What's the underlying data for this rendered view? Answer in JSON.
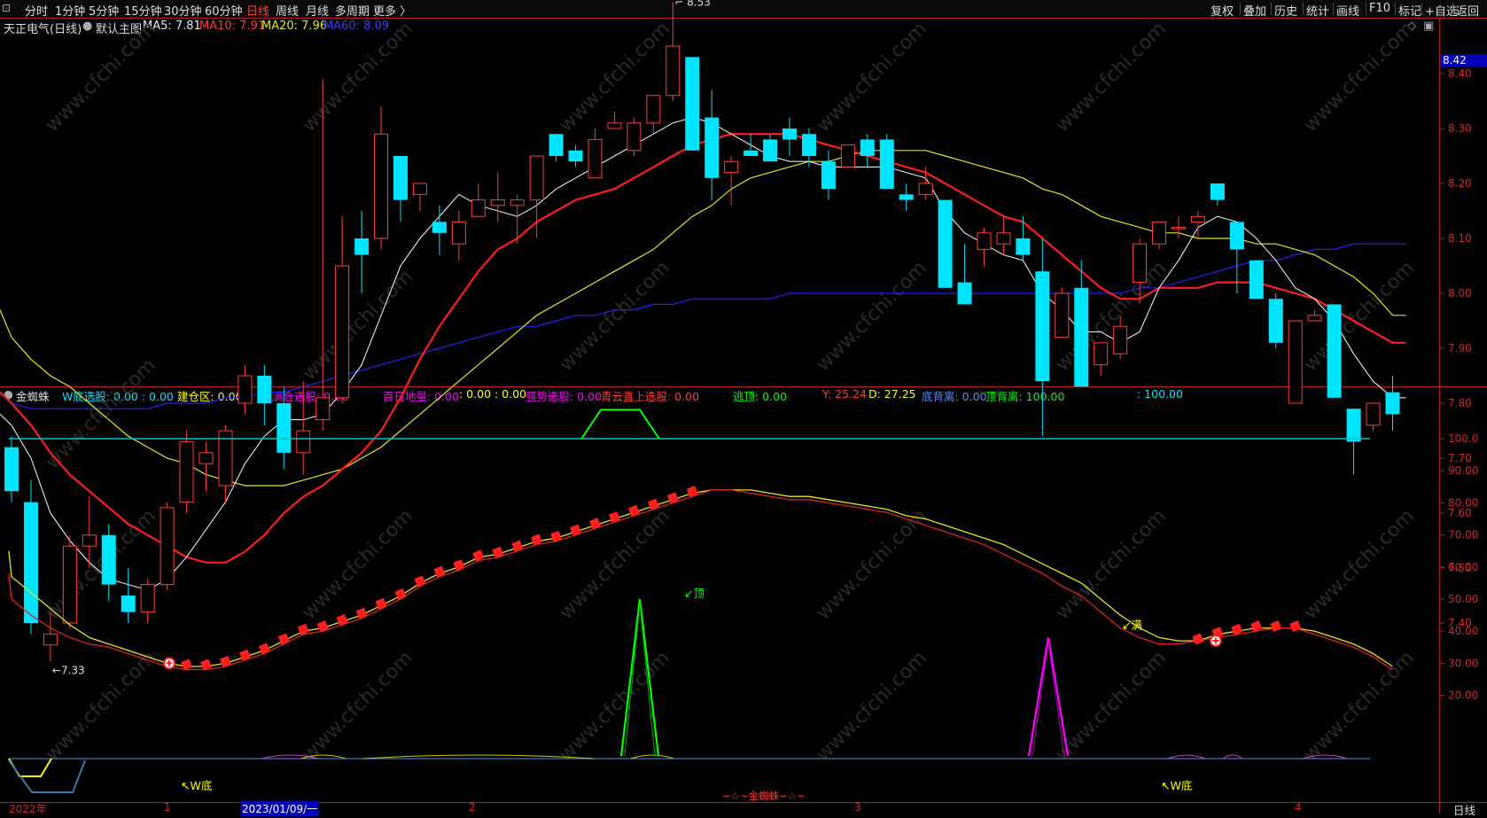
{
  "toolbar": {
    "left_tabs": [
      "分时",
      "1分钟",
      "5分钟",
      "15分钟",
      "30分钟",
      "60分钟",
      "日线",
      "周线",
      "月线",
      "多周期",
      "更多 〉"
    ],
    "active_tab": "日线",
    "right_tabs": [
      "复权",
      "叠加",
      "历史",
      "统计",
      "画线",
      "F10",
      "标记",
      "+自选",
      "返回"
    ]
  },
  "main_chart": {
    "title": "天正电气(日线)",
    "template": "默认主图",
    "ma5": "MA5: 7.81",
    "ma10": "MA10: 7.91",
    "ma20": "MA20: 7.96",
    "ma60": "MA60: 8.09",
    "high_label": "8.53",
    "low_label": "7.33",
    "price_now": "8.42",
    "y_ticks": [
      "8.40",
      "8.30",
      "8.20",
      "8.10",
      "8.00",
      "7.90",
      "7.80",
      "7.70",
      "7.60",
      "7.50",
      "7.40"
    ],
    "colors": {
      "up": "#ff3c3c",
      "down": "#00e5ff",
      "ma5": "#e8e8e8",
      "ma10": "#ff1e1e",
      "ma20": "#e6e61e",
      "ma60": "#2222ff"
    },
    "candles": [
      [
        7.72,
        7.74,
        7.62,
        7.64
      ],
      [
        7.62,
        7.66,
        7.38,
        7.4
      ],
      [
        7.36,
        7.42,
        7.33,
        7.38
      ],
      [
        7.4,
        7.56,
        7.39,
        7.54
      ],
      [
        7.54,
        7.63,
        7.5,
        7.56
      ],
      [
        7.56,
        7.58,
        7.44,
        7.47
      ],
      [
        7.45,
        7.5,
        7.4,
        7.42
      ],
      [
        7.42,
        7.48,
        7.4,
        7.47
      ],
      [
        7.47,
        7.62,
        7.46,
        7.61
      ],
      [
        7.62,
        7.75,
        7.6,
        7.73
      ],
      [
        7.69,
        7.73,
        7.64,
        7.71
      ],
      [
        7.65,
        7.76,
        7.62,
        7.75
      ],
      [
        7.8,
        7.87,
        7.78,
        7.85
      ],
      [
        7.85,
        7.87,
        7.76,
        7.8
      ],
      [
        7.8,
        7.83,
        7.68,
        7.71
      ],
      [
        7.71,
        7.84,
        7.67,
        7.75
      ],
      [
        7.77,
        8.39,
        7.75,
        7.81
      ],
      [
        7.81,
        8.14,
        7.8,
        8.05
      ],
      [
        8.1,
        8.15,
        8.0,
        8.07
      ],
      [
        8.1,
        8.34,
        8.08,
        8.29
      ],
      [
        8.25,
        8.25,
        8.13,
        8.17
      ],
      [
        8.18,
        8.2,
        8.15,
        8.2
      ],
      [
        8.13,
        8.16,
        8.07,
        8.11
      ],
      [
        8.09,
        8.15,
        8.06,
        8.13
      ],
      [
        8.14,
        8.2,
        8.14,
        8.17
      ],
      [
        8.16,
        8.22,
        8.13,
        8.17
      ],
      [
        8.16,
        8.18,
        8.09,
        8.17
      ],
      [
        8.17,
        8.25,
        8.1,
        8.25
      ],
      [
        8.29,
        8.29,
        8.24,
        8.25
      ],
      [
        8.26,
        8.27,
        8.23,
        8.24
      ],
      [
        8.21,
        8.3,
        8.21,
        8.28
      ],
      [
        8.3,
        8.33,
        8.3,
        8.31
      ],
      [
        8.26,
        8.32,
        8.25,
        8.31
      ],
      [
        8.31,
        8.36,
        8.29,
        8.36
      ],
      [
        8.36,
        8.53,
        8.35,
        8.45
      ],
      [
        8.43,
        8.43,
        8.26,
        8.26
      ],
      [
        8.32,
        8.37,
        8.17,
        8.21
      ],
      [
        8.22,
        8.25,
        8.16,
        8.24
      ],
      [
        8.26,
        8.29,
        8.25,
        8.25
      ],
      [
        8.28,
        8.29,
        8.24,
        8.24
      ],
      [
        8.3,
        8.32,
        8.25,
        8.28
      ],
      [
        8.29,
        8.3,
        8.23,
        8.25
      ],
      [
        8.24,
        8.26,
        8.17,
        8.19
      ],
      [
        8.23,
        8.27,
        8.23,
        8.27
      ],
      [
        8.28,
        8.29,
        8.23,
        8.25
      ],
      [
        8.28,
        8.29,
        8.19,
        8.19
      ],
      [
        8.18,
        8.2,
        8.15,
        8.17
      ],
      [
        8.18,
        8.23,
        8.17,
        8.2
      ],
      [
        8.17,
        8.17,
        8.01,
        8.01
      ],
      [
        8.02,
        8.09,
        7.98,
        7.98
      ],
      [
        8.08,
        8.12,
        8.05,
        8.11
      ],
      [
        8.09,
        8.14,
        8.07,
        8.11
      ],
      [
        8.1,
        8.14,
        8.06,
        8.07
      ],
      [
        8.04,
        8.1,
        7.74,
        7.84
      ],
      [
        7.92,
        8.01,
        7.92,
        8.0
      ],
      [
        8.01,
        8.06,
        7.83,
        7.83
      ],
      [
        7.87,
        7.91,
        7.85,
        7.91
      ],
      [
        7.89,
        7.96,
        7.88,
        7.94
      ],
      [
        8.02,
        8.1,
        7.98,
        8.09
      ],
      [
        8.09,
        8.13,
        8.08,
        8.13
      ],
      [
        8.12,
        8.14,
        8.1,
        8.12
      ],
      [
        8.13,
        8.15,
        8.1,
        8.14
      ],
      [
        8.2,
        8.2,
        8.16,
        8.17
      ],
      [
        8.13,
        8.13,
        8.0,
        8.08
      ],
      [
        8.06,
        8.06,
        7.99,
        7.99
      ],
      [
        7.99,
        8.0,
        7.9,
        7.91
      ],
      [
        7.8,
        7.95,
        7.8,
        7.95
      ],
      [
        7.95,
        7.97,
        7.95,
        7.96
      ],
      [
        7.98,
        7.98,
        7.81,
        7.81
      ],
      [
        7.79,
        7.79,
        7.67,
        7.73
      ],
      [
        7.76,
        7.8,
        7.75,
        7.8
      ],
      [
        7.82,
        7.85,
        7.75,
        7.78
      ]
    ],
    "ma5_values": [
      7.76,
      7.7,
      7.6,
      7.55,
      7.51,
      7.48,
      7.47,
      7.46,
      7.48,
      7.52,
      7.57,
      7.62,
      7.69,
      7.74,
      7.77,
      7.77,
      7.78,
      7.82,
      7.87,
      7.96,
      8.05,
      8.1,
      8.14,
      8.18,
      8.16,
      8.15,
      8.14,
      8.16,
      8.19,
      8.21,
      8.23,
      8.25,
      8.27,
      8.29,
      8.31,
      8.32,
      8.31,
      8.29,
      8.27,
      8.25,
      8.24,
      8.24,
      8.23,
      8.23,
      8.23,
      8.23,
      8.22,
      8.21,
      8.15,
      8.11,
      8.09,
      8.07,
      8.06,
      8.0,
      7.97,
      7.93,
      7.93,
      7.91,
      7.93,
      8.01,
      8.06,
      8.12,
      8.14,
      8.13,
      8.1,
      8.06,
      8.01,
      7.99,
      7.95,
      7.89,
      7.84,
      7.81
    ],
    "ma10_values": [
      7.8,
      7.76,
      7.71,
      7.67,
      7.64,
      7.61,
      7.58,
      7.56,
      7.54,
      7.52,
      7.51,
      7.51,
      7.53,
      7.56,
      7.6,
      7.63,
      7.65,
      7.68,
      7.71,
      7.75,
      7.81,
      7.88,
      7.94,
      7.99,
      8.04,
      8.08,
      8.1,
      8.13,
      8.15,
      8.17,
      8.18,
      8.19,
      8.21,
      8.23,
      8.25,
      8.27,
      8.28,
      8.29,
      8.29,
      8.29,
      8.29,
      8.28,
      8.27,
      8.26,
      8.25,
      8.24,
      8.23,
      8.22,
      8.2,
      8.18,
      8.16,
      8.14,
      8.13,
      8.1,
      8.07,
      8.04,
      8.01,
      7.99,
      7.99,
      8.01,
      8.01,
      8.01,
      8.02,
      8.02,
      8.02,
      8.01,
      8.0,
      7.99,
      7.97,
      7.95,
      7.93,
      7.91
    ],
    "ma20_values": [
      7.92,
      7.88,
      7.85,
      7.83,
      7.8,
      7.77,
      7.74,
      7.72,
      7.7,
      7.69,
      7.67,
      7.66,
      7.65,
      7.65,
      7.65,
      7.66,
      7.67,
      7.68,
      7.7,
      7.72,
      7.75,
      7.78,
      7.81,
      7.84,
      7.87,
      7.9,
      7.93,
      7.96,
      7.98,
      8.0,
      8.02,
      8.04,
      8.06,
      8.08,
      8.11,
      8.14,
      8.16,
      8.19,
      8.21,
      8.22,
      8.23,
      8.24,
      8.24,
      8.25,
      8.26,
      8.26,
      8.26,
      8.26,
      8.25,
      8.24,
      8.23,
      8.22,
      8.21,
      8.19,
      8.18,
      8.16,
      8.14,
      8.13,
      8.12,
      8.11,
      8.11,
      8.1,
      8.1,
      8.1,
      8.09,
      8.09,
      8.08,
      8.07,
      8.05,
      8.03,
      8.0,
      7.96
    ],
    "ma60_values": [
      7.8,
      7.79,
      7.79,
      7.79,
      7.79,
      7.79,
      7.79,
      7.79,
      7.8,
      7.8,
      7.8,
      7.81,
      7.81,
      7.82,
      7.82,
      7.83,
      7.84,
      7.85,
      7.86,
      7.87,
      7.88,
      7.89,
      7.9,
      7.91,
      7.92,
      7.93,
      7.94,
      7.94,
      7.95,
      7.96,
      7.96,
      7.97,
      7.97,
      7.98,
      7.98,
      7.99,
      7.99,
      7.99,
      7.99,
      7.99,
      8.0,
      8.0,
      8.0,
      8.0,
      8.0,
      8.0,
      8.0,
      8.0,
      8.0,
      8.0,
      8.0,
      8.0,
      8.0,
      8.0,
      8.0,
      8.0,
      8.0,
      8.0,
      8.01,
      8.01,
      8.02,
      8.03,
      8.04,
      8.05,
      8.06,
      8.06,
      8.07,
      8.08,
      8.08,
      8.09,
      8.09,
      8.09
    ]
  },
  "indicator": {
    "name": "金蜘蛛",
    "w_bottom": "W底选股: 0.00 : 0.00",
    "build_zone": "建仓区: 0.00",
    "full_position": "满仓选股: 0.00",
    "hundred_day_low": "百日地量: 0.00",
    "colon_values": ": 0.00 : 0.00",
    "strong_pick": "强势选股: 0.00",
    "qingyun": "青云直上选股: 0.00",
    "escape_top": "逃顶: 0.00",
    "y_value": "Y: 25.24",
    "d_value": "D: 27.25",
    "bottom_div": "底背离: 0.00",
    "top_div": "顶背离: 100.00",
    "last_value": ": 100.00",
    "y_ticks": [
      "100.0",
      "90.00",
      "80.00",
      "70.00",
      "60.00",
      "50.00",
      "40.00",
      "30.00",
      "20.00"
    ],
    "top_label": "顶",
    "full_label": "满",
    "w_label1": "W底",
    "w_label2": "W底",
    "footer_label": "~☆~金蜘蛛~☆~",
    "y_line": [
      57,
      52,
      47,
      42,
      38,
      36,
      34,
      32,
      30,
      29,
      29,
      30,
      32,
      34,
      37,
      40,
      41,
      43,
      45,
      48,
      51,
      55,
      58,
      60,
      63,
      64,
      66,
      68,
      69,
      71,
      73,
      75,
      77,
      79,
      81,
      83,
      84,
      84,
      84,
      83,
      82,
      82,
      81,
      80,
      79,
      78,
      76,
      75,
      73,
      71,
      69,
      67,
      64,
      61,
      58,
      55,
      50,
      45,
      41,
      38,
      37,
      37,
      39,
      40,
      41,
      41,
      41,
      40,
      38,
      36,
      33,
      29
    ],
    "d_line": [
      50,
      45,
      41,
      38,
      36,
      35,
      33,
      31,
      29,
      28,
      28,
      29,
      31,
      33,
      36,
      39,
      40,
      42,
      44,
      47,
      50,
      54,
      57,
      59,
      62,
      63,
      65,
      67,
      68,
      70,
      72,
      74,
      76,
      78,
      80,
      82,
      84,
      84,
      83,
      82,
      81,
      81,
      80,
      79,
      78,
      77,
      75,
      73,
      71,
      69,
      67,
      64,
      61,
      58,
      54,
      51,
      46,
      41,
      38,
      36,
      36,
      37,
      38,
      39,
      40,
      41,
      41,
      39,
      37,
      35,
      32,
      28
    ]
  },
  "xaxis": {
    "labels": [
      "2022年",
      "1",
      "2023/01/09/一",
      "2",
      "3",
      "4"
    ],
    "period": "日线"
  },
  "watermark": "www.cfchi.com"
}
